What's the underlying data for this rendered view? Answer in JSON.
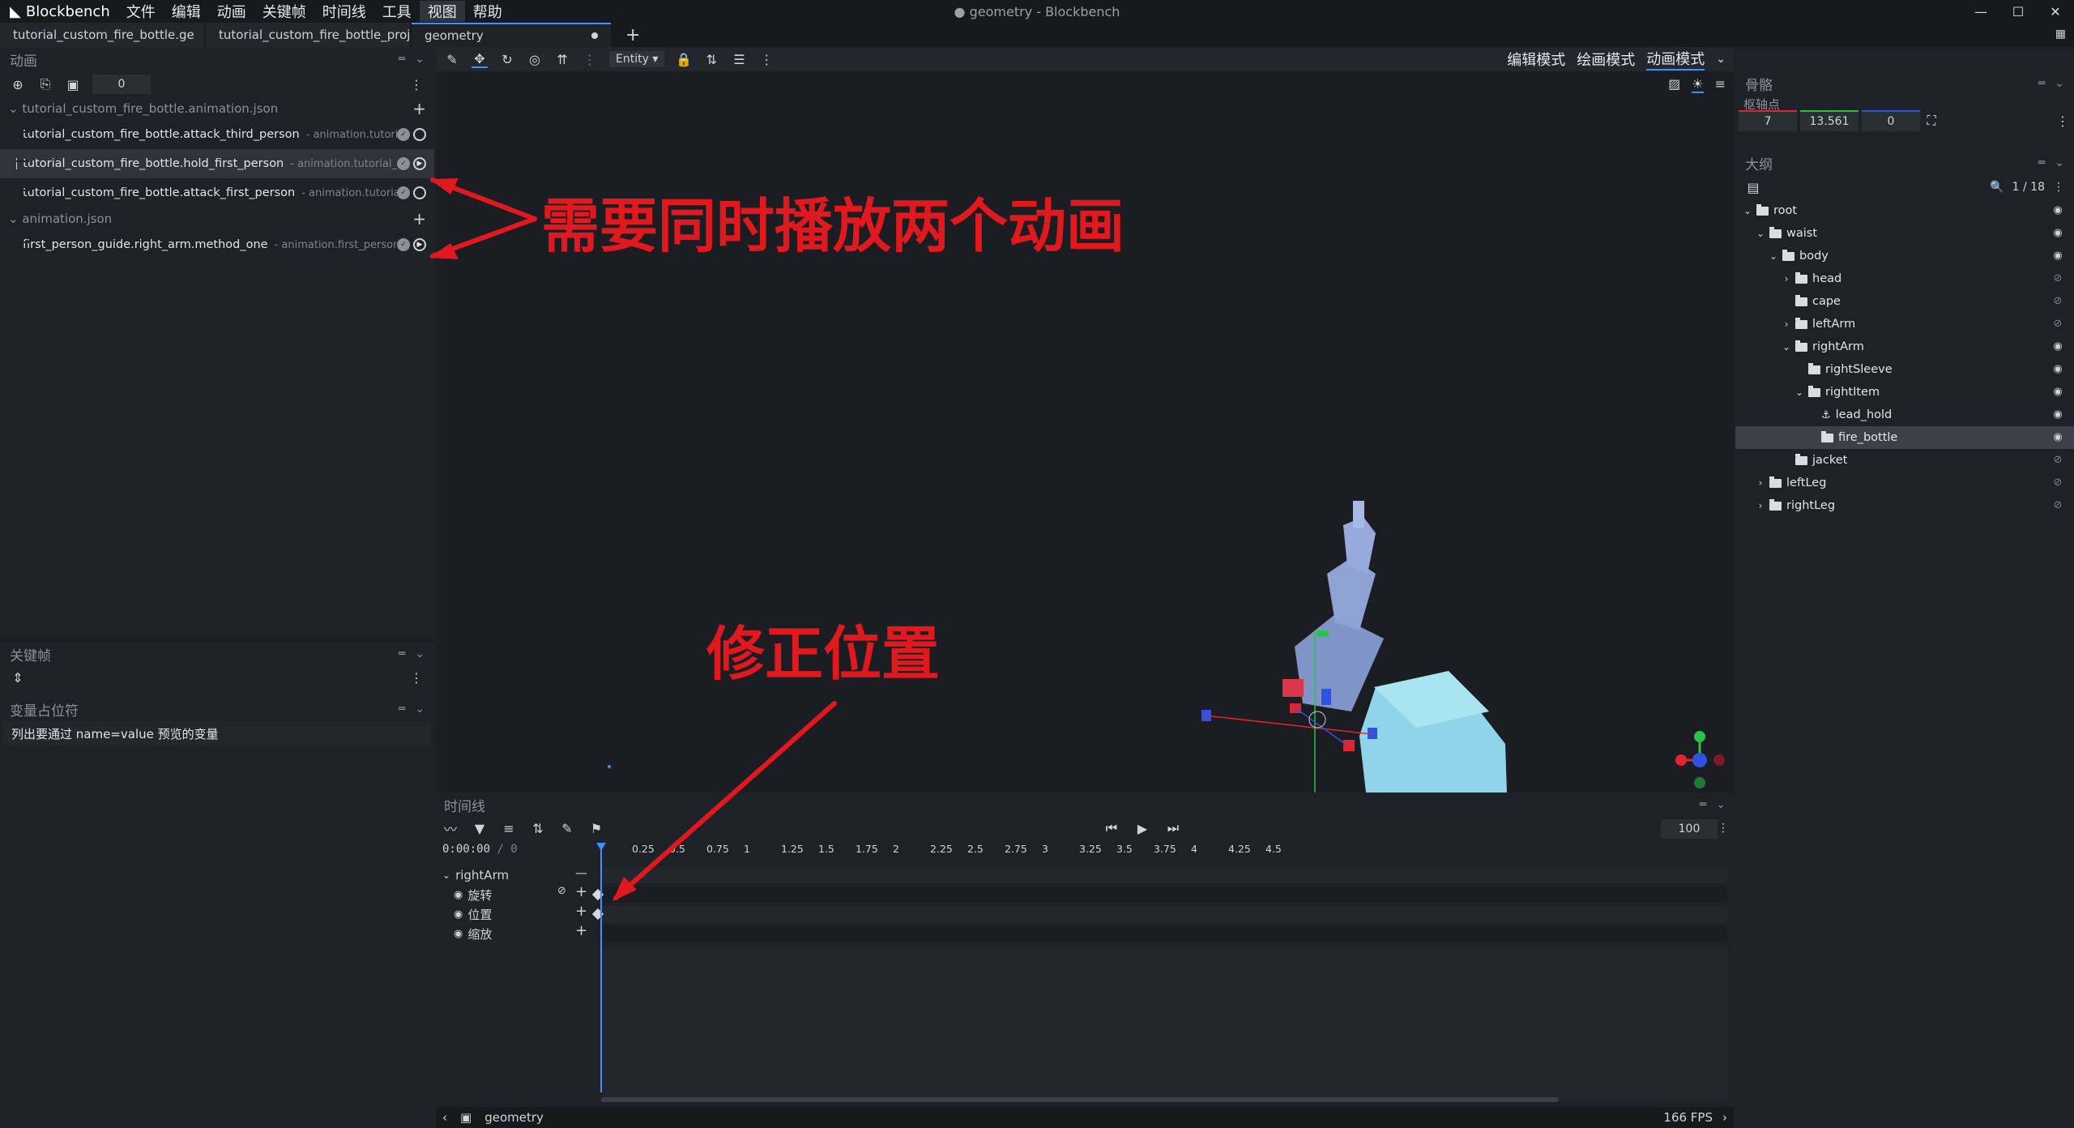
{
  "app": {
    "name": "Blockbench",
    "window_title": "● geometry - Blockbench",
    "menu": [
      "文件",
      "编辑",
      "动画",
      "关键帧",
      "时间线",
      "工具",
      "视图",
      "帮助"
    ]
  },
  "tabs": [
    {
      "label": "tutorial_custom_fire_bottle.ge"
    },
    {
      "label": "tutorial_custom_fire_bottle_proje"
    },
    {
      "label": "geometry"
    }
  ],
  "animations_panel": {
    "title": "动画",
    "counter": "0",
    "groups": [
      {
        "name": "tutorial_custom_fire_bottle.animation.json",
        "items": [
          {
            "name": "tutorial_custom_fire_bottle.attack_third_person",
            "sub": "- animation.tutori"
          },
          {
            "name": "tutorial_custom_fire_bottle.hold_first_person",
            "sub": "- animation.tutorial_"
          },
          {
            "name": "tutorial_custom_fire_bottle.attack_first_person",
            "sub": "- animation.tutoria"
          }
        ]
      },
      {
        "name": "animation.json",
        "items": [
          {
            "name": "first_person_guide.right_arm.method_one",
            "sub": "- animation.first_person"
          }
        ]
      }
    ]
  },
  "keyframe_panel": {
    "title": "关键帧"
  },
  "variable_panel": {
    "title": "变量占位符",
    "hint": "列出要通过 name=value 预览的变量"
  },
  "viewport_toolbar": {
    "entity_label": "Entity"
  },
  "modes": [
    "编辑模式",
    "绘画模式",
    "动画模式"
  ],
  "bones_panel": {
    "title": "骨骼",
    "pivot_label": "枢轴点",
    "pivot": [
      "7",
      "13.561",
      "0"
    ]
  },
  "outline_panel": {
    "title": "大纲",
    "count": "1 / 18",
    "items": [
      {
        "name": "root",
        "depth": 0,
        "chevron": "open",
        "visible": true
      },
      {
        "name": "waist",
        "depth": 1,
        "chevron": "open",
        "visible": true
      },
      {
        "name": "body",
        "depth": 2,
        "chevron": "open",
        "visible": true
      },
      {
        "name": "head",
        "depth": 3,
        "chevron": "closed",
        "visible": false
      },
      {
        "name": "cape",
        "depth": 3,
        "chevron": "none",
        "visible": false
      },
      {
        "name": "leftArm",
        "depth": 3,
        "chevron": "closed",
        "visible": false
      },
      {
        "name": "rightArm",
        "depth": 3,
        "chevron": "open",
        "visible": true
      },
      {
        "name": "rightSleeve",
        "depth": 4,
        "chevron": "none",
        "visible": true
      },
      {
        "name": "rightItem",
        "depth": 4,
        "chevron": "open",
        "visible": true
      },
      {
        "name": "lead_hold",
        "depth": 5,
        "chevron": "none",
        "visible": true,
        "icon": "anchor"
      },
      {
        "name": "fire_bottle",
        "depth": 5,
        "chevron": "none",
        "visible": true,
        "selected": true
      },
      {
        "name": "jacket",
        "depth": 3,
        "chevron": "none",
        "visible": false
      },
      {
        "name": "leftLeg",
        "depth": 1,
        "chevron": "closed",
        "visible": false
      },
      {
        "name": "rightLeg",
        "depth": 1,
        "chevron": "closed",
        "visible": false
      }
    ]
  },
  "timeline": {
    "title": "时间线",
    "time": "0:00:00",
    "length": "/ 0",
    "fps_input": "100",
    "ticks": [
      "0.25",
      "0.5",
      "0.75",
      "1",
      "1.25",
      "1.5",
      "1.75",
      "2",
      "2.25",
      "2.5",
      "2.75",
      "3",
      "3.25",
      "3.5",
      "3.75",
      "4",
      "4.25",
      "4.5"
    ],
    "bone": "rightArm",
    "channels": [
      "旋转",
      "位置",
      "缩放"
    ]
  },
  "status_bar": {
    "model": "geometry",
    "fps": "166 FPS"
  },
  "annotations": {
    "play_two": "需要同时播放两个动画",
    "fix_position": "修正位置"
  },
  "colors": {
    "accent": "#3e90ff",
    "annotation": "#e0191e",
    "selection": "#2f333b"
  }
}
